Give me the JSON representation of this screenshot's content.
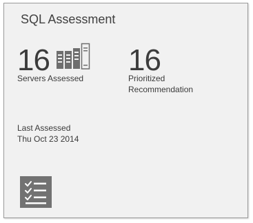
{
  "tile": {
    "title": "SQL Assessment",
    "servers": {
      "count": "16",
      "label": "Servers Assessed",
      "icon": "server-rack-icon"
    },
    "recommendations": {
      "count": "16",
      "label_line1": "Prioritized",
      "label_line2": "Recommendation"
    },
    "last_assessed": {
      "label": "Last Assessed",
      "date": "Thu Oct 23 2014"
    },
    "action_icon": "checklist-icon"
  },
  "colors": {
    "tile_background": "#f1f1f1",
    "tile_border": "#9a9a9a",
    "text": "#3a3a3a",
    "icon_gray": "#727272"
  }
}
